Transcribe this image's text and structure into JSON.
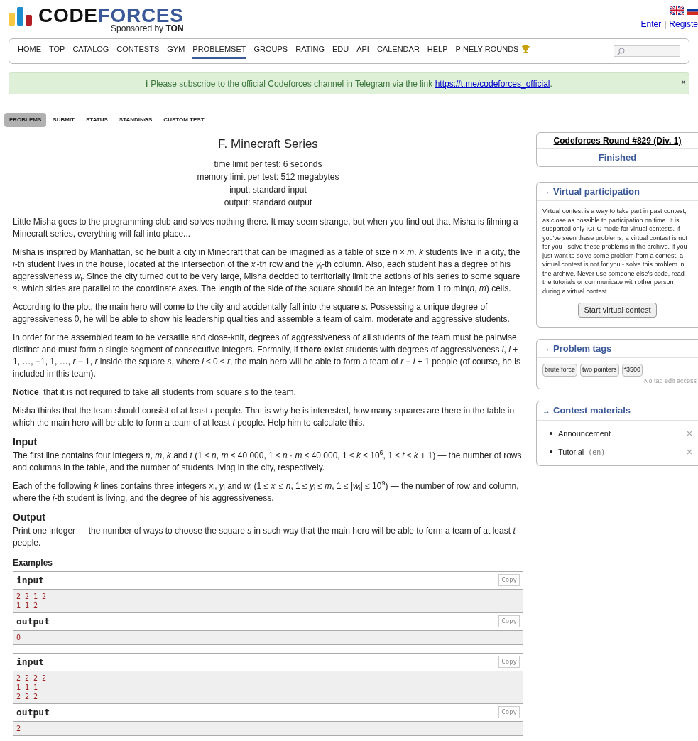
{
  "header": {
    "logo": {
      "word_1": "CODE",
      "word_2": "FORCES",
      "sponsor": "Sponsored by",
      "sponsor_name": "TON"
    },
    "auth": [
      {
        "label": "Enter"
      },
      {
        "label": "Registe"
      }
    ],
    "separator": "|"
  },
  "nav": {
    "items": [
      {
        "label": "HOME",
        "selected": false
      },
      {
        "label": "TOP",
        "selected": false
      },
      {
        "label": "CATALOG",
        "selected": false
      },
      {
        "label": "CONTESTS",
        "selected": false
      },
      {
        "label": "GYM",
        "selected": false
      },
      {
        "label": "PROBLEMSET",
        "selected": true
      },
      {
        "label": "GROUPS",
        "selected": false
      },
      {
        "label": "RATING",
        "selected": false
      },
      {
        "label": "EDU",
        "selected": false
      },
      {
        "label": "API",
        "selected": false
      },
      {
        "label": "CALENDAR",
        "selected": false
      },
      {
        "label": "HELP",
        "selected": false
      },
      {
        "label": "PINELY ROUNDS",
        "selected": false
      }
    ]
  },
  "alert": {
    "icon": "ℹ",
    "text": "Please subscribe to the official Codeforces channel in Telegram via the link",
    "link": "https://t.me/codeforces_official",
    "end": ".",
    "close": "×"
  },
  "subnav": [
    {
      "label": "PROBLEMS",
      "selected": true
    },
    {
      "label": "SUBMIT",
      "selected": false
    },
    {
      "label": "STATUS",
      "selected": false
    },
    {
      "label": "STANDINGS",
      "selected": false
    },
    {
      "label": "CUSTOM TEST",
      "selected": false
    }
  ],
  "problem": {
    "title": "F. Minecraft Series",
    "limits": [
      "time limit per test: 6 seconds",
      "memory limit per test: 512 megabytes",
      "input: standard input",
      "output: standard output"
    ],
    "statement": [
      "Little Misha goes to the programming club and solves nothing there. It may seem strange, but when you find out that Misha is filming a Minecraft series, everything will fall into place...",
      "Misha is inspired by Manhattan, so he built a city in Minecraft that can be imagined as a table of size *n* × *m*. *k* students live in a city, the *i*-th student lives in the house, located at the intersection of the *x*$_{i}$-th row and the *y*$_{i}$-th column. Also, each student has a degree of his aggressiveness *w*$_{i}$. Since the city turned out to be very large, Misha decided to territorially limit the actions of his series to some square *s*, which sides are parallel to the coordinate axes. The length of the side of the square should be an integer from 1 to min(*n*, *m*) cells.",
      "According to the plot, the main hero will come to the city and accidentally fall into the square *s*. Possessing a unique degree of aggressiveness 0, he will be able to show his leadership qualities and assemble a team of calm, moderate and aggressive students.",
      "In order for the assembled team to be versatile and close-knit, degrees of aggressiveness of all students of the team must be pairwise distinct and must form a single segment of consecutive integers. Formally, if **there exist** students with degrees of aggressiveness *l*, *l* + 1, …, −1, 1, …, *r* − 1, *r* inside the square *s*, where *l* ≤ 0 ≤ *r*, the main hero will be able to form a team of *r* − *l* + 1 people (of course, he is included in this team).",
      "**Notice**, that it is not required to take all students from square *s* to the team.",
      "Misha thinks that the team should consist of at least *t* people. That is why he is interested, how many squares are there in the table in which the main hero will be able to form a team of at least *t* people. Help him to calculate this."
    ],
    "sections": [
      {
        "title": "Input",
        "paragraphs": [
          "The first line contains four integers *n*, *m*, *k* and *t* (1 ≤ *n*, *m* ≤ 40 000, 1 ≤ *n* · *m* ≤ 40 000, 1 ≤ *k* ≤ 10$^{6}$, 1 ≤ *t* ≤ *k* + 1) — the number of rows and columns in the table, and the number of students living in the city, respectively.",
          "Each of the following *k* lines contains three integers *x*$_{i}$, *y*$_{i}$ and *w*$_{i}$ (1 ≤ *x*$_{i}$ ≤ *n*, 1 ≤ *y*$_{i}$ ≤ *m*, 1 ≤ |*w*$_{i}$| ≤ 10$^{9}$) — the number of row and column, where the *i*-th student is living, and the degree of his aggressiveness."
        ]
      },
      {
        "title": "Output",
        "paragraphs": [
          "Print one integer — the number of ways to choose the square *s* in such way that the main hero will be able to form a team of at least *t* people."
        ]
      }
    ],
    "examples_title": "Examples",
    "examples": [
      {
        "blocks": [
          {
            "label": "input",
            "copy": "Copy",
            "lines": [
              "2 2 1 2",
              "1 1 2"
            ]
          },
          {
            "label": "output",
            "copy": "Copy",
            "lines": [
              "0"
            ]
          }
        ]
      },
      {
        "blocks": [
          {
            "label": "input",
            "copy": "Copy",
            "lines": [
              "2 2 2 2",
              "1 1 1",
              "2 2 2"
            ]
          },
          {
            "label": "output",
            "copy": "Copy",
            "lines": [
              "2"
            ]
          }
        ]
      }
    ]
  },
  "sidebar": {
    "contest": {
      "name": "Codeforces Round #829 (Div. 1)",
      "status": "Finished"
    },
    "virtual": {
      "arrow": "→",
      "title": "Virtual participation",
      "text": "Virtual contest is a way to take part in past contest, as close as possible to participation on time. It is supported only ICPC mode for virtual contests. If you've seen these problems, a virtual contest is not for you - solve these problems in the archive. If you just want to solve some problem from a contest, a virtual contest is not for you - solve this problem in the archive. Never use someone else's code, read the tutorials or communicate with other person during a virtual contest.",
      "button": "Start virtual contest"
    },
    "tags": {
      "arrow": "→",
      "title": "Problem tags",
      "items": [
        "brute force",
        "two pointers",
        "*3500"
      ],
      "note": "No tag edit access"
    },
    "materials": {
      "arrow": "→",
      "title": "Contest materials",
      "items": [
        {
          "label": "Announcement"
        },
        {
          "label": "Tutorial",
          "lang": "(en)"
        }
      ]
    }
  }
}
